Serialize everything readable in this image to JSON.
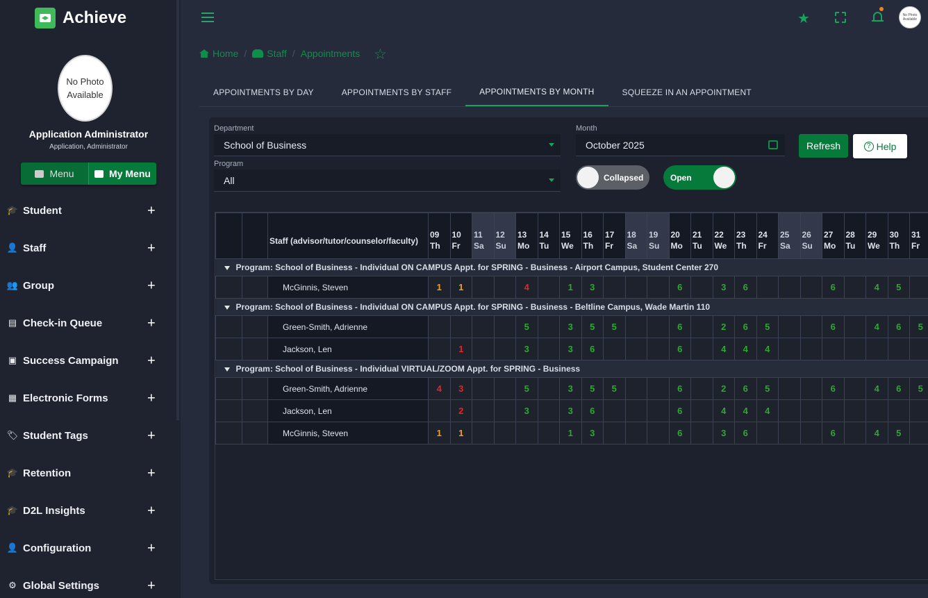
{
  "app": {
    "name": "Achieve"
  },
  "user": {
    "photo_text": "No Photo Available",
    "name": "Application Administrator",
    "role": "Application, Administrator"
  },
  "menu_toggle": {
    "menu": "Menu",
    "my_menu": "My Menu"
  },
  "sidebar": {
    "items": [
      {
        "label": "Student",
        "icon": "student-icon"
      },
      {
        "label": "Staff",
        "icon": "staff-icon"
      },
      {
        "label": "Group",
        "icon": "group-icon"
      },
      {
        "label": "Check-in Queue",
        "icon": "checkin-icon"
      },
      {
        "label": "Success Campaign",
        "icon": "campaign-icon"
      },
      {
        "label": "Electronic Forms",
        "icon": "forms-icon"
      },
      {
        "label": "Student Tags",
        "icon": "tags-icon"
      },
      {
        "label": "Retention",
        "icon": "retention-icon"
      },
      {
        "label": "D2L Insights",
        "icon": "insights-icon"
      },
      {
        "label": "Configuration",
        "icon": "configuration-icon"
      },
      {
        "label": "Global Settings",
        "icon": "settings-icon"
      }
    ]
  },
  "topbar": {
    "avatar_text": "No Photo Available"
  },
  "breadcrumb": {
    "home": "Home",
    "staff": "Staff",
    "current": "Appointments"
  },
  "tabs": [
    "APPOINTMENTS BY DAY",
    "APPOINTMENTS BY STAFF",
    "APPOINTMENTS BY MONTH",
    "SQUEEZE IN AN APPOINTMENT"
  ],
  "filters": {
    "department_label": "Department",
    "department_value": "School of Business",
    "program_label": "Program",
    "program_value": "All",
    "month_label": "Month",
    "month_value": "October 2025",
    "refresh": "Refresh",
    "help": "Help",
    "toggle_collapsed": "Collapsed",
    "toggle_open": "Open"
  },
  "grid": {
    "staff_header": "Staff (advisor/tutor/counselor/faculty)",
    "days": [
      {
        "d": "09",
        "w": "Th",
        "weekend": false
      },
      {
        "d": "10",
        "w": "Fr",
        "weekend": false
      },
      {
        "d": "11",
        "w": "Sa",
        "weekend": true
      },
      {
        "d": "12",
        "w": "Su",
        "weekend": true
      },
      {
        "d": "13",
        "w": "Mo",
        "weekend": false
      },
      {
        "d": "14",
        "w": "Tu",
        "weekend": false
      },
      {
        "d": "15",
        "w": "We",
        "weekend": false
      },
      {
        "d": "16",
        "w": "Th",
        "weekend": false
      },
      {
        "d": "17",
        "w": "Fr",
        "weekend": false
      },
      {
        "d": "18",
        "w": "Sa",
        "weekend": true
      },
      {
        "d": "19",
        "w": "Su",
        "weekend": true
      },
      {
        "d": "20",
        "w": "Mo",
        "weekend": false
      },
      {
        "d": "21",
        "w": "Tu",
        "weekend": false
      },
      {
        "d": "22",
        "w": "We",
        "weekend": false
      },
      {
        "d": "23",
        "w": "Th",
        "weekend": false
      },
      {
        "d": "24",
        "w": "Fr",
        "weekend": false
      },
      {
        "d": "25",
        "w": "Sa",
        "weekend": true
      },
      {
        "d": "26",
        "w": "Su",
        "weekend": true
      },
      {
        "d": "27",
        "w": "Mo",
        "weekend": false
      },
      {
        "d": "28",
        "w": "Tu",
        "weekend": false
      },
      {
        "d": "29",
        "w": "We",
        "weekend": false
      },
      {
        "d": "30",
        "w": "Th",
        "weekend": false
      },
      {
        "d": "31",
        "w": "Fr",
        "weekend": false
      }
    ],
    "groups": [
      {
        "title": "Program: School of Business - Individual ON CAMPUS Appt. for SPRING - Business - Airport Campus, Student Center 270",
        "rows": [
          {
            "name": "McGinnis, Steven",
            "cells": [
              "1o",
              "1o",
              "",
              "",
              "4r",
              "",
              "1g",
              "3g",
              "",
              "",
              "",
              "6g",
              "",
              "3g",
              "6g",
              "",
              "",
              "",
              "6g",
              "",
              "4g",
              "5g",
              ""
            ]
          }
        ]
      },
      {
        "title": "Program: School of Business - Individual ON CAMPUS Appt. for SPRING - Business - Beltline Campus, Wade Martin 110",
        "rows": [
          {
            "name": "Green-Smith, Adrienne",
            "cells": [
              "",
              "",
              "",
              "",
              "5g",
              "",
              "3g",
              "5g",
              "5g",
              "",
              "",
              "6g",
              "",
              "2g",
              "6g",
              "5g",
              "",
              "",
              "6g",
              "",
              "4g",
              "6g",
              "5g"
            ]
          },
          {
            "name": "Jackson, Len",
            "cells": [
              "",
              "1r",
              "",
              "",
              "3g",
              "",
              "3g",
              "6g",
              "",
              "",
              "",
              "6g",
              "",
              "4g",
              "4g",
              "4g",
              "",
              "",
              "",
              "",
              "",
              "",
              ""
            ]
          }
        ]
      },
      {
        "title": "Program: School of Business - Individual VIRTUAL/ZOOM Appt. for SPRING - Business",
        "rows": [
          {
            "name": "Green-Smith, Adrienne",
            "cells": [
              "4r",
              "3r",
              "",
              "",
              "5g",
              "",
              "3g",
              "5g",
              "5g",
              "",
              "",
              "6g",
              "",
              "2g",
              "6g",
              "5g",
              "",
              "",
              "6g",
              "",
              "4g",
              "6g",
              "5g"
            ]
          },
          {
            "name": "Jackson, Len",
            "cells": [
              "",
              "2r",
              "",
              "",
              "3g",
              "",
              "3g",
              "6g",
              "",
              "",
              "",
              "6g",
              "",
              "4g",
              "4g",
              "4g",
              "",
              "",
              "",
              "",
              "",
              "",
              ""
            ]
          },
          {
            "name": "McGinnis, Steven",
            "cells": [
              "1o",
              "1o",
              "",
              "",
              "",
              "",
              "1g",
              "3g",
              "",
              "",
              "",
              "6g",
              "",
              "3g",
              "6g",
              "",
              "",
              "",
              "6g",
              "",
              "4g",
              "5g",
              ""
            ]
          }
        ]
      }
    ]
  },
  "colors": {
    "accent": "#067a3b",
    "count_green": "#2da82f",
    "count_orange": "#f2a01c",
    "count_red": "#ee2020"
  }
}
